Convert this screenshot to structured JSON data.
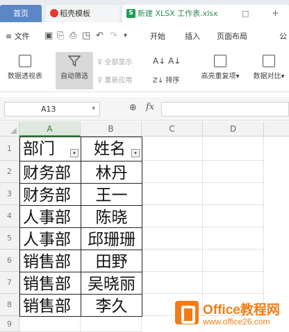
{
  "tabs": {
    "home": "首页",
    "templates": "稻壳模板",
    "file": "新建 XLSX 工作表.xlsx",
    "file_icon": "S",
    "close": "□",
    "plus": "+"
  },
  "menu": {
    "file": "≡ 文件",
    "items": [
      "开始",
      "插入",
      "页面布局",
      "公"
    ]
  },
  "ribbon": {
    "pivot": "数据透视表",
    "autofilter": "自动筛选",
    "show_all": "全部显示",
    "reapply": "重新应用",
    "sort": "排序",
    "highlight_dup": "高亮重复项",
    "data_compare": "数据对比"
  },
  "formula_bar": {
    "cell_ref": "A13",
    "fx": "fx"
  },
  "grid": {
    "columns": [
      "A",
      "B",
      "C",
      "D"
    ],
    "rows": [
      "1",
      "2",
      "3",
      "4",
      "5",
      "6",
      "7",
      "8",
      "9"
    ],
    "header": [
      "部门",
      "姓名"
    ],
    "data": [
      [
        "财务部",
        "林丹"
      ],
      [
        "财务部",
        "王一"
      ],
      [
        "人事部",
        "陈晓"
      ],
      [
        "人事部",
        "邱珊珊"
      ],
      [
        "销售部",
        "田野"
      ],
      [
        "销售部",
        "吴晓丽"
      ],
      [
        "销售部",
        "李久"
      ]
    ]
  },
  "watermark": {
    "title": "Office教程网",
    "url": "www.office26.com"
  },
  "colors": {
    "accent_green": "#1ea04f",
    "logo_orange": "#f07d17",
    "home_tab": "#5b87c7"
  }
}
